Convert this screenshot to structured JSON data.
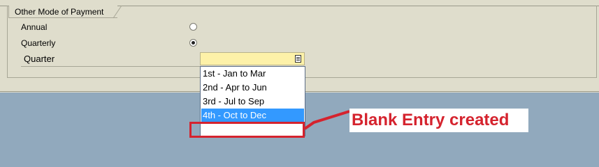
{
  "group": {
    "title": "Other Mode of Payment"
  },
  "options": {
    "annual_label": "Annual",
    "quarterly_label": "Quarterly"
  },
  "quarter": {
    "label": "Quarter",
    "value": "",
    "items": [
      "1st - Jan to Mar",
      "2nd - Apr to Jun",
      "3rd - Jul to Sep",
      "4th - Oct to Dec",
      ""
    ],
    "selected_index": 3
  },
  "annotation": {
    "text": "Blank Entry created",
    "color": "#d5232e"
  },
  "colors": {
    "panel": "#dfddcc",
    "backdrop": "#91a9bd",
    "combo_bg": "#fdf1a8",
    "selection": "#3399ff"
  }
}
